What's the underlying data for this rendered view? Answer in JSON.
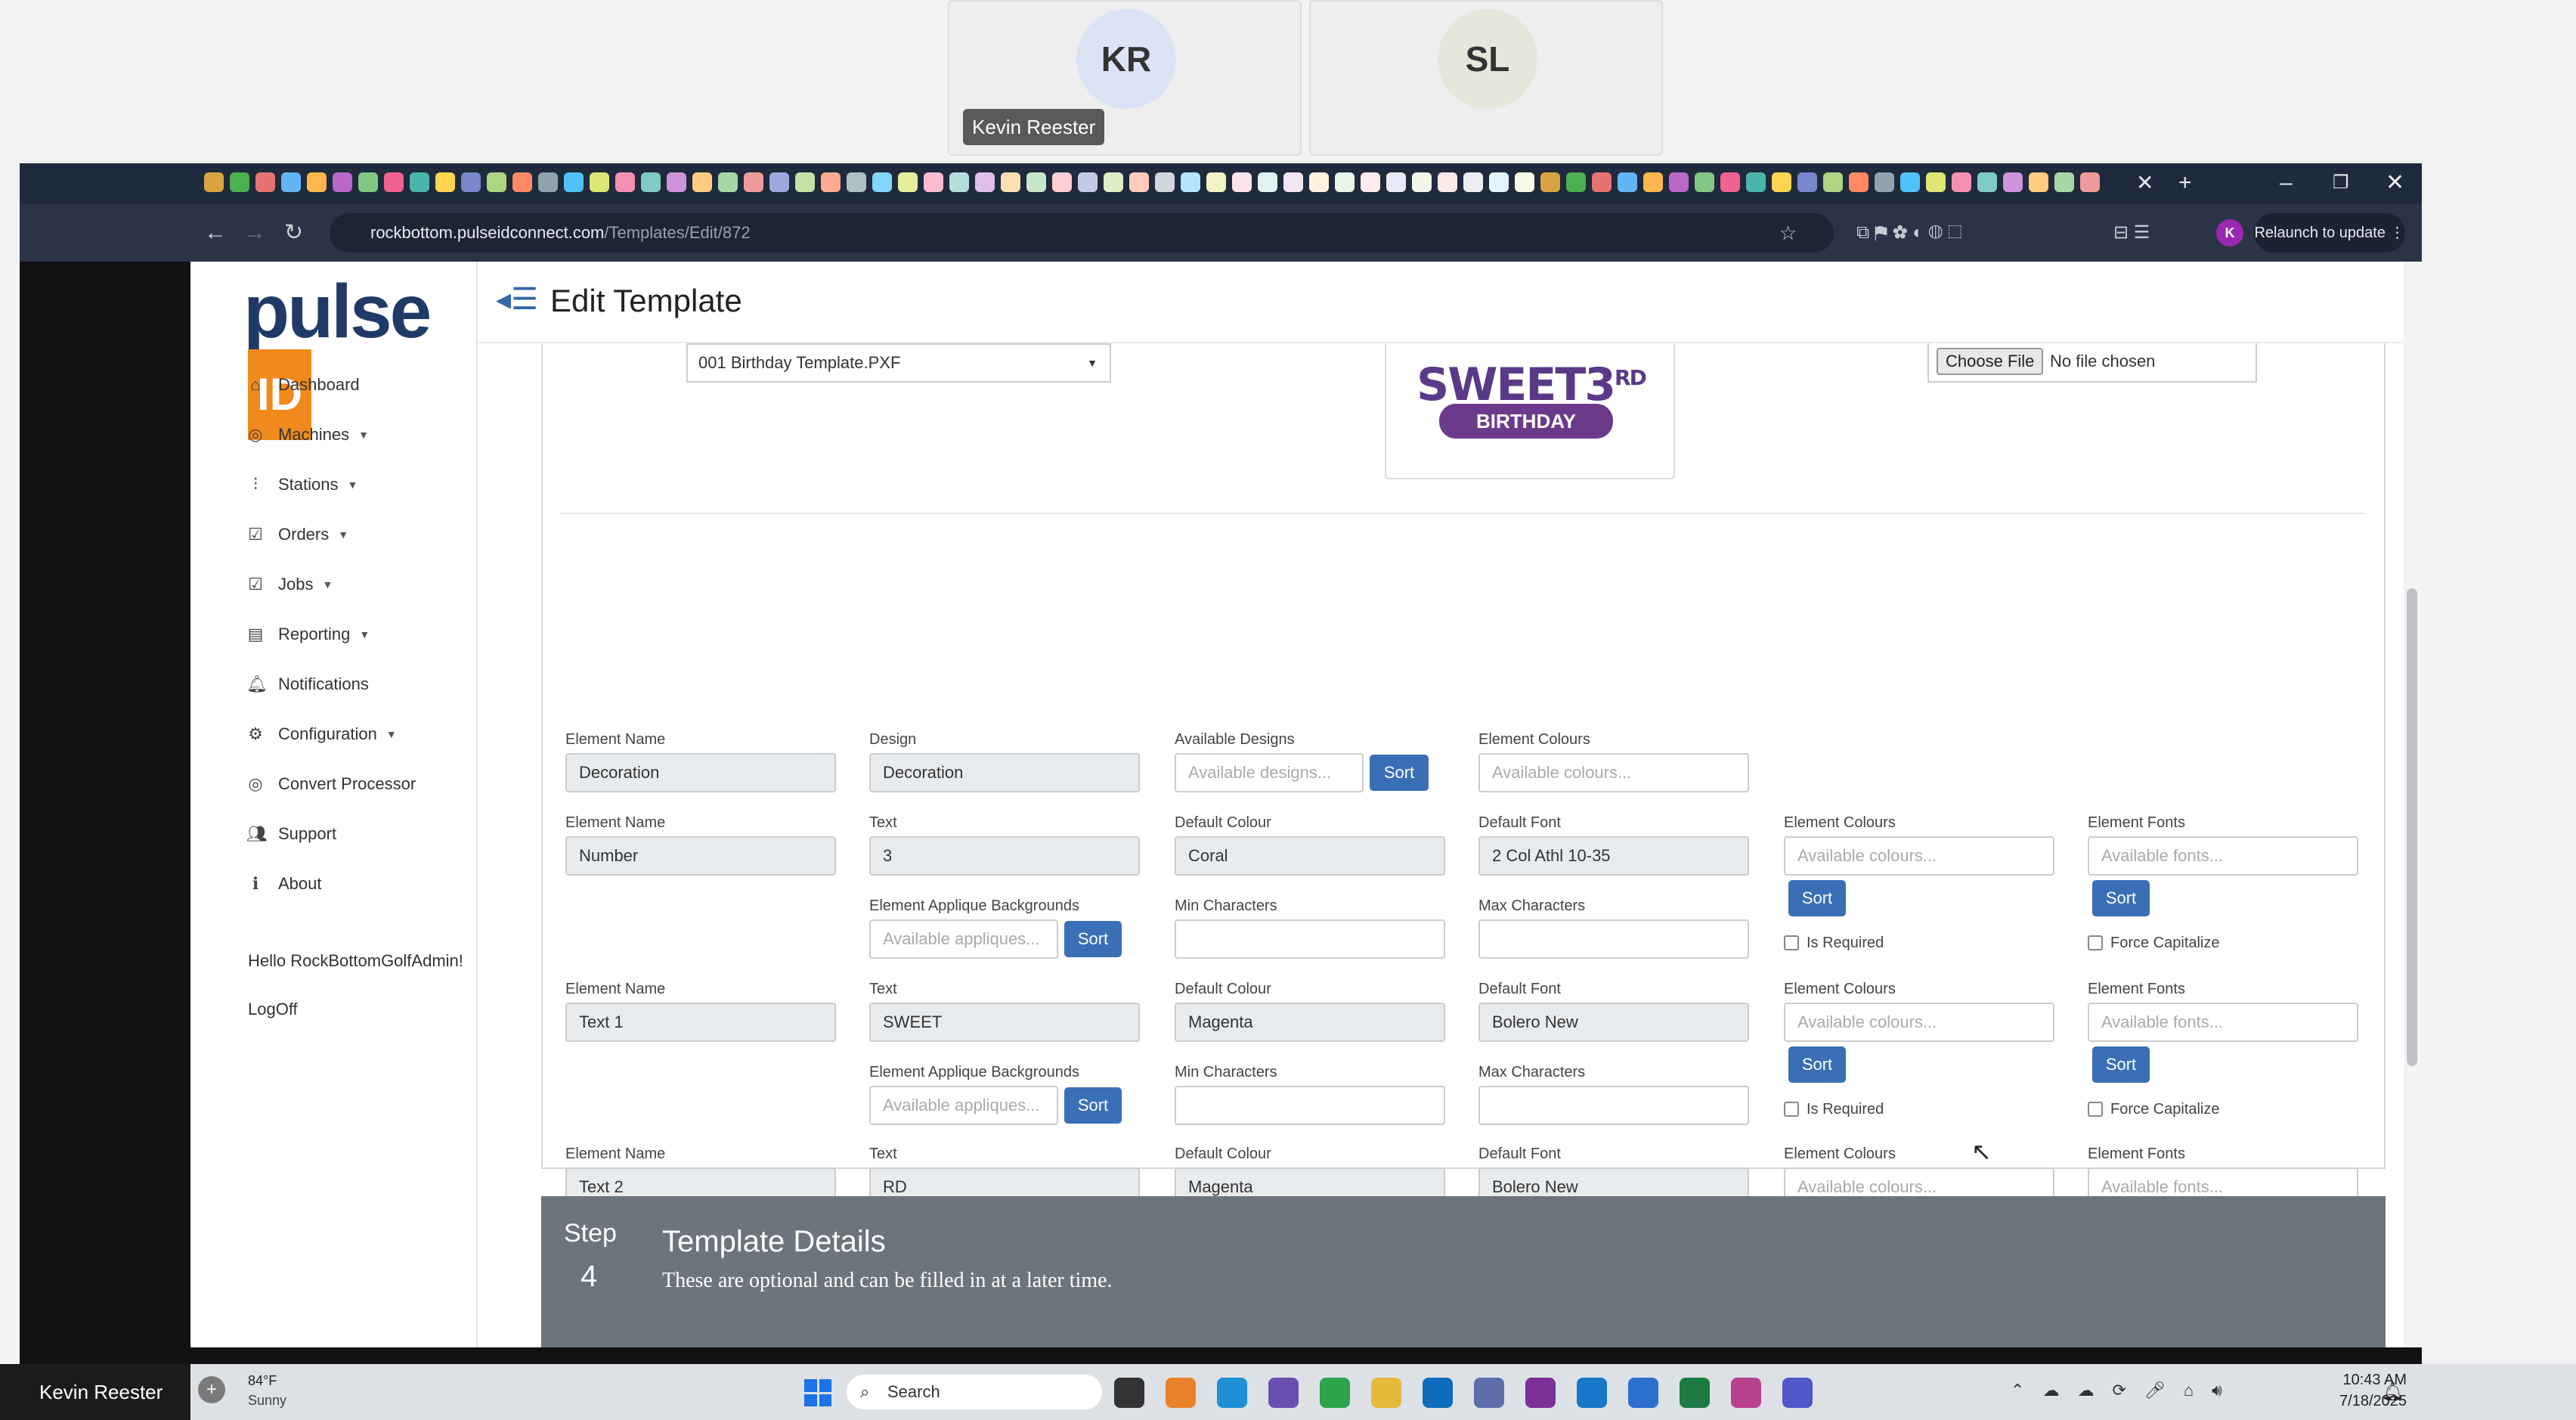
{
  "meeting": {
    "participants": [
      {
        "initials": "KR"
      },
      {
        "initials": "SL"
      }
    ],
    "hover_name": "Kevin Reester"
  },
  "browser": {
    "url_host": "rockbottom.pulseidconnect.com",
    "url_path": "/Templates/Edit/872",
    "relaunch_label": "Relaunch to update",
    "profile_initial": "K"
  },
  "app": {
    "logo_text": "pulse",
    "logo_badge": "ID",
    "page_title": "Edit Template",
    "nav": [
      {
        "label": "Dashboard",
        "icon": "home-icon"
      },
      {
        "label": "Machines",
        "icon": "machine-icon",
        "dropdown": true
      },
      {
        "label": "Stations",
        "icon": "station-icon",
        "dropdown": true
      },
      {
        "label": "Orders",
        "icon": "orders-icon",
        "dropdown": true
      },
      {
        "label": "Jobs",
        "icon": "jobs-icon",
        "dropdown": true
      },
      {
        "label": "Reporting",
        "icon": "reporting-icon",
        "dropdown": true
      },
      {
        "label": "Notifications",
        "icon": "bell-icon"
      },
      {
        "label": "Configuration",
        "icon": "gear-icon",
        "dropdown": true
      },
      {
        "label": "Convert Processor",
        "icon": "convert-icon"
      },
      {
        "label": "Support",
        "icon": "support-icon"
      },
      {
        "label": "About",
        "icon": "info-icon"
      }
    ],
    "greeting": "Hello RockBottomGolfAdmin!",
    "logoff": "LogOff"
  },
  "template": {
    "file_select": "001 Birthday Template.PXF",
    "preview_text_main": "SWEET",
    "preview_text_num": "3",
    "preview_text_sup": "RD",
    "preview_banner": "BIRTHDAY",
    "choose_file": "Choose File",
    "no_file": "No file chosen"
  },
  "labels": {
    "element_name": "Element Name",
    "design": "Design",
    "available_designs": "Available Designs",
    "element_colours": "Element Colours",
    "text": "Text",
    "default_colour": "Default Colour",
    "default_font": "Default Font",
    "element_fonts": "Element Fonts",
    "applique_bg": "Element Applique Backgrounds",
    "min_chars": "Min Characters",
    "max_chars": "Max Characters",
    "is_required": "Is Required",
    "force_capitalize": "Force Capitalize",
    "sort": "Sort"
  },
  "placeholders": {
    "designs": "Available designs...",
    "colours": "Available colours...",
    "fonts": "Available fonts...",
    "appliques": "Available appliques..."
  },
  "decoration": {
    "name": "Decoration",
    "design": "Decoration"
  },
  "elements": [
    {
      "name": "Number",
      "text": "3",
      "colour": "Coral",
      "font": "2 Col Athl 10-35"
    },
    {
      "name": "Text 1",
      "text": "SWEET",
      "colour": "Magenta",
      "font": "Bolero New"
    },
    {
      "name": "Text 2",
      "text": "RD",
      "colour": "Magenta",
      "font": "Bolero New"
    }
  ],
  "step": {
    "label": "Step",
    "number": "4",
    "title": "Template Details",
    "subtitle": "These are optional and can be filled in at a later time."
  },
  "taskbar": {
    "user": "Kevin Reester",
    "temp": "84°F",
    "condition": "Sunny",
    "search": "Search",
    "time": "10:43 AM",
    "date": "7/18/2025"
  },
  "colors": {
    "brand_navy": "#1f3a66",
    "brand_orange": "#f08a1c",
    "button_blue": "#3a6fb5",
    "step_gray": "#6c757d"
  }
}
